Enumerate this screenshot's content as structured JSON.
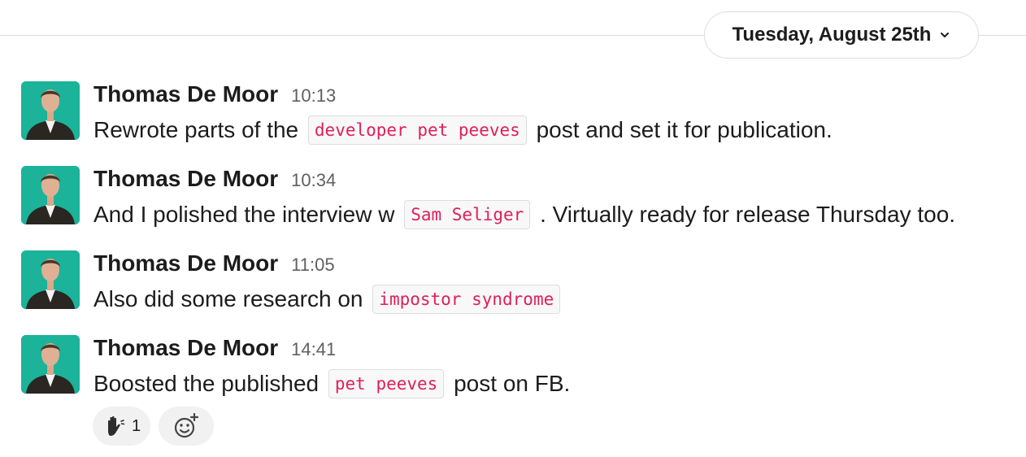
{
  "date_divider": {
    "label": "Tuesday, August 25th",
    "icon": "chevron-down-icon"
  },
  "messages": [
    {
      "author": "Thomas De Moor",
      "time": "10:13",
      "parts": {
        "before": "Rewrote parts of the",
        "code": "developer pet peeves",
        "after": "post and set it for publication."
      }
    },
    {
      "author": "Thomas De Moor",
      "time": "10:34",
      "parts": {
        "before": "And I polished the interview w",
        "code": "Sam Seliger",
        "after": ". Virtually ready for release Thursday too."
      }
    },
    {
      "author": "Thomas De Moor",
      "time": "11:05",
      "parts": {
        "before": "Also did some research on",
        "code": "impostor syndrome",
        "after": ""
      }
    },
    {
      "author": "Thomas De Moor",
      "time": "14:41",
      "parts": {
        "before": "Boosted the published",
        "code": "pet peeves",
        "after": "post on FB."
      }
    }
  ],
  "reactions": [
    {
      "icon": "raised-hand-icon",
      "count": "1"
    },
    {
      "icon": "add-emoji-icon"
    }
  ],
  "colors": {
    "code_text": "#e01e5a",
    "avatar_bg": "#1bb39a",
    "muted": "#616061"
  }
}
